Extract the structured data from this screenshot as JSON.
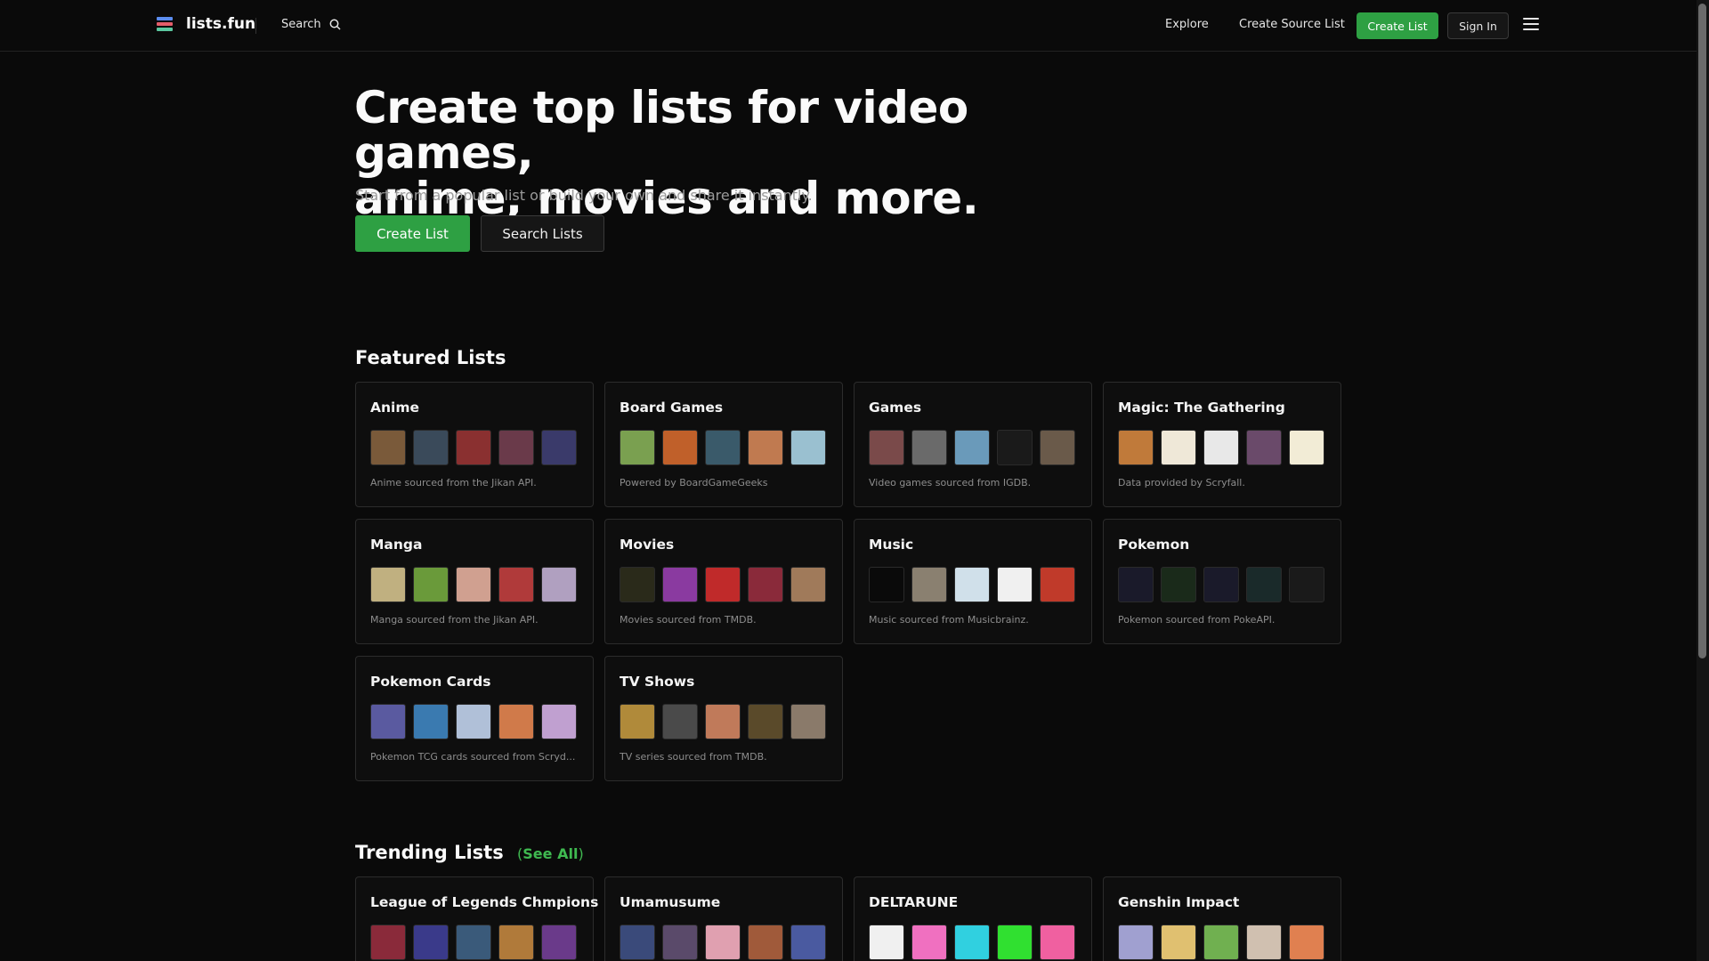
{
  "header": {
    "logo_text": "lists.fun",
    "search_label": "Search",
    "nav": {
      "explore": "Explore",
      "create_source_list": "Create Source List",
      "create_list": "Create List",
      "sign_in": "Sign In"
    }
  },
  "hero": {
    "title_line1": "Create top lists for video games,",
    "title_line2": "anime, movies and more.",
    "subtitle": "Start from a popular list or build your own and share it instantly.",
    "create_button": "Create List",
    "search_button": "Search Lists"
  },
  "featured": {
    "title": "Featured Lists",
    "cards": [
      {
        "title": "Anime",
        "desc": "Anime sourced from the Jikan API.",
        "thumbs": [
          "#7a5a3a",
          "#3a4a5a",
          "#8a3030",
          "#6a3a4a",
          "#3a3a6a"
        ]
      },
      {
        "title": "Board Games",
        "desc": "Powered by BoardGameGeeks",
        "thumbs": [
          "#7aa050",
          "#c0602a",
          "#3a5a6a",
          "#c07a50",
          "#9ac0d0"
        ]
      },
      {
        "title": "Games",
        "desc": "Video games sourced from IGDB.",
        "thumbs": [
          "#7a4a4a",
          "#6a6a6a",
          "#6a9aba",
          "#1a1a1a",
          "#6a5a4a"
        ]
      },
      {
        "title": "Magic: The Gathering",
        "desc": "Data provided by Scryfall.",
        "thumbs": [
          "#c07a3a",
          "#efe8d8",
          "#e8e8e8",
          "#6a4a6a",
          "#f2ecd6"
        ]
      },
      {
        "title": "Manga",
        "desc": "Manga sourced from the Jikan API.",
        "thumbs": [
          "#c0b080",
          "#6a9a3a",
          "#d0a090",
          "#b03a3a",
          "#b0a0c0"
        ]
      },
      {
        "title": "Movies",
        "desc": "Movies sourced from TMDB.",
        "thumbs": [
          "#2a2a1a",
          "#8a3aa0",
          "#c02a2a",
          "#8a2a3a",
          "#a07a5a"
        ]
      },
      {
        "title": "Music",
        "desc": "Music sourced from Musicbrainz.",
        "thumbs": [
          "#0a0a0a",
          "#8a8070",
          "#d0e0ea",
          "#f0f0f0",
          "#c03a2a"
        ]
      },
      {
        "title": "Pokemon",
        "desc": "Pokemon sourced from PokeAPI.",
        "thumbs": [
          "#1a1a2a",
          "#1a2a1a",
          "#1a1a2a",
          "#1a2a2a",
          "#1a1a1a"
        ]
      },
      {
        "title": "Pokemon Cards",
        "desc": "Pokemon TCG cards sourced from Scryd...",
        "thumbs": [
          "#5a5aa0",
          "#3a7ab0",
          "#b0c0d8",
          "#d07a4a",
          "#c0a0d0"
        ]
      },
      {
        "title": "TV Shows",
        "desc": "TV series sourced from TMDB.",
        "thumbs": [
          "#b08a3a",
          "#4a4a4a",
          "#c07a5a",
          "#5a4a2a",
          "#8a7a6a"
        ]
      }
    ]
  },
  "trending": {
    "title": "Trending Lists",
    "see_all_open": "(",
    "see_all": "See All",
    "see_all_close": ")",
    "cards": [
      {
        "title": "League of Legends Chmpions",
        "thumbs": [
          "#8a2a3a",
          "#3a3a8a",
          "#3a5a7a",
          "#b07a3a",
          "#6a3a8a"
        ]
      },
      {
        "title": "Umamusume",
        "thumbs": [
          "#3a4a7a",
          "#5a4a6a",
          "#e0a0b0",
          "#a05a3a",
          "#4a5aa0"
        ]
      },
      {
        "title": "DELTARUNE",
        "thumbs": [
          "#f0f0f0",
          "#f070c0",
          "#30d0e0",
          "#30e030",
          "#f060a0"
        ]
      },
      {
        "title": "Genshin Impact",
        "thumbs": [
          "#a0a0d0",
          "#e0c070",
          "#70b050",
          "#d0c0b0",
          "#e08050"
        ]
      }
    ]
  }
}
